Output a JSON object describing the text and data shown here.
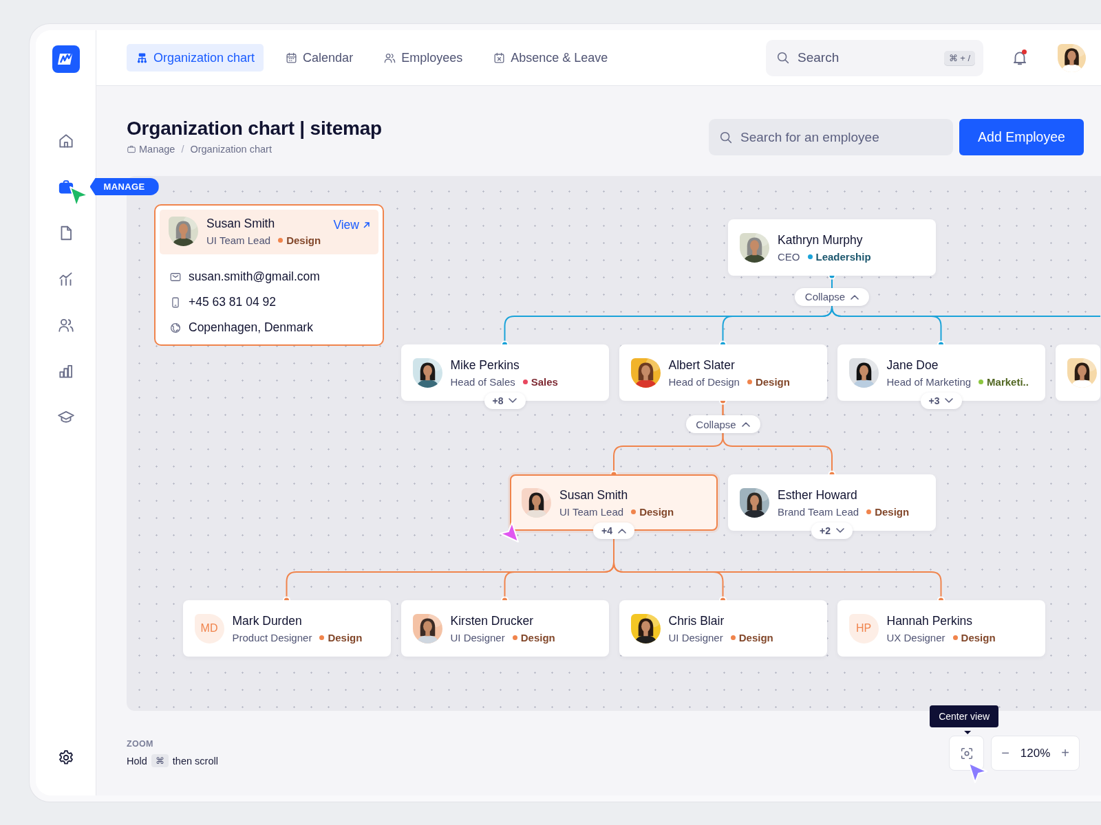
{
  "sidebar": {
    "items": [
      {
        "selected": false
      },
      {
        "selected": true,
        "tooltip": "MANAGE"
      },
      {
        "selected": false
      },
      {
        "selected": false
      },
      {
        "selected": false
      },
      {
        "selected": false
      },
      {
        "selected": false
      }
    ]
  },
  "tabs": [
    {
      "label": "Organization chart",
      "selected": true
    },
    {
      "label": "Calendar",
      "selected": false
    },
    {
      "label": "Employees",
      "selected": false
    },
    {
      "label": "Absence & Leave",
      "selected": false
    }
  ],
  "search": {
    "placeholder": "Search",
    "shortcut": "⌘ + /"
  },
  "notifications": {
    "unread": true
  },
  "page": {
    "title": "Organization chart | sitemap",
    "breadcrumb": [
      "Manage",
      "Organization chart"
    ],
    "breadcrumb_separator": "/",
    "employee_search": {
      "placeholder": "Search for an employee"
    },
    "add_button": "Add Employee"
  },
  "profile_card": {
    "name": "Susan Smith",
    "role": "UI Team Lead",
    "department": {
      "name": "Design",
      "color": "#f0844c"
    },
    "link": "View",
    "email": "susan.smith@gmail.com",
    "phone": "+45 63 81 04 92",
    "location": "Copenhagen, Denmark"
  },
  "org_chart": {
    "root": {
      "name": "Kathryn Murphy",
      "role": "CEO",
      "department": {
        "name": "Leadership",
        "color": "#1aa3d9"
      },
      "selected": false,
      "toggle": {
        "kind": "collapse",
        "label": "Collapse",
        "expanded": true
      },
      "children": [
        {
          "name": "Mike Perkins",
          "role": "Head of Sales",
          "department": {
            "name": "Sales",
            "color": "#e8485f"
          },
          "selected": false,
          "toggle": {
            "kind": "count",
            "label": "+8",
            "expanded": false
          }
        },
        {
          "name": "Albert Slater",
          "role": "Head of Design",
          "department": {
            "name": "Design",
            "color": "#f0844c"
          },
          "selected": false,
          "toggle": {
            "kind": "collapse",
            "label": "Collapse",
            "expanded": true
          },
          "children": [
            {
              "name": "Susan Smith",
              "role": "UI Team Lead",
              "department": {
                "name": "Design",
                "color": "#f0844c"
              },
              "selected": true,
              "toggle": {
                "kind": "count",
                "label": "+4",
                "expanded": true
              },
              "children": [
                {
                  "name": "Mark Durden",
                  "role": "Product Designer",
                  "department": {
                    "name": "Design",
                    "color": "#f0844c"
                  },
                  "selected": false,
                  "avatar": {
                    "kind": "initials",
                    "text": "MD"
                  }
                },
                {
                  "name": "Kirsten Drucker",
                  "role": "UI Designer",
                  "department": {
                    "name": "Design",
                    "color": "#f0844c"
                  },
                  "selected": false
                },
                {
                  "name": "Chris Blair",
                  "role": "UI Designer",
                  "department": {
                    "name": "Design",
                    "color": "#f0844c"
                  },
                  "selected": false
                },
                {
                  "name": "Hannah Perkins",
                  "role": "UX Designer",
                  "department": {
                    "name": "Design",
                    "color": "#f0844c"
                  },
                  "selected": false,
                  "avatar": {
                    "kind": "initials",
                    "text": "HP"
                  }
                }
              ]
            },
            {
              "name": "Esther Howard",
              "role": "Brand Team Lead",
              "department": {
                "name": "Design",
                "color": "#f0844c"
              },
              "selected": false,
              "toggle": {
                "kind": "count",
                "label": "+2",
                "expanded": false
              }
            }
          ]
        },
        {
          "name": "Jane Doe",
          "role": "Head of Marketing",
          "department": {
            "name": "Marketi..",
            "color": "#8cc63f"
          },
          "selected": false,
          "toggle": {
            "kind": "count",
            "label": "+3",
            "expanded": false
          }
        },
        {
          "selected": false
        }
      ]
    }
  },
  "zoom": {
    "label": "ZOOM",
    "hint_before": "Hold",
    "hint_key": "⌘",
    "hint_after": "then scroll",
    "center_tooltip": "Center view",
    "minus": "−",
    "value": "120%",
    "plus": "+"
  }
}
